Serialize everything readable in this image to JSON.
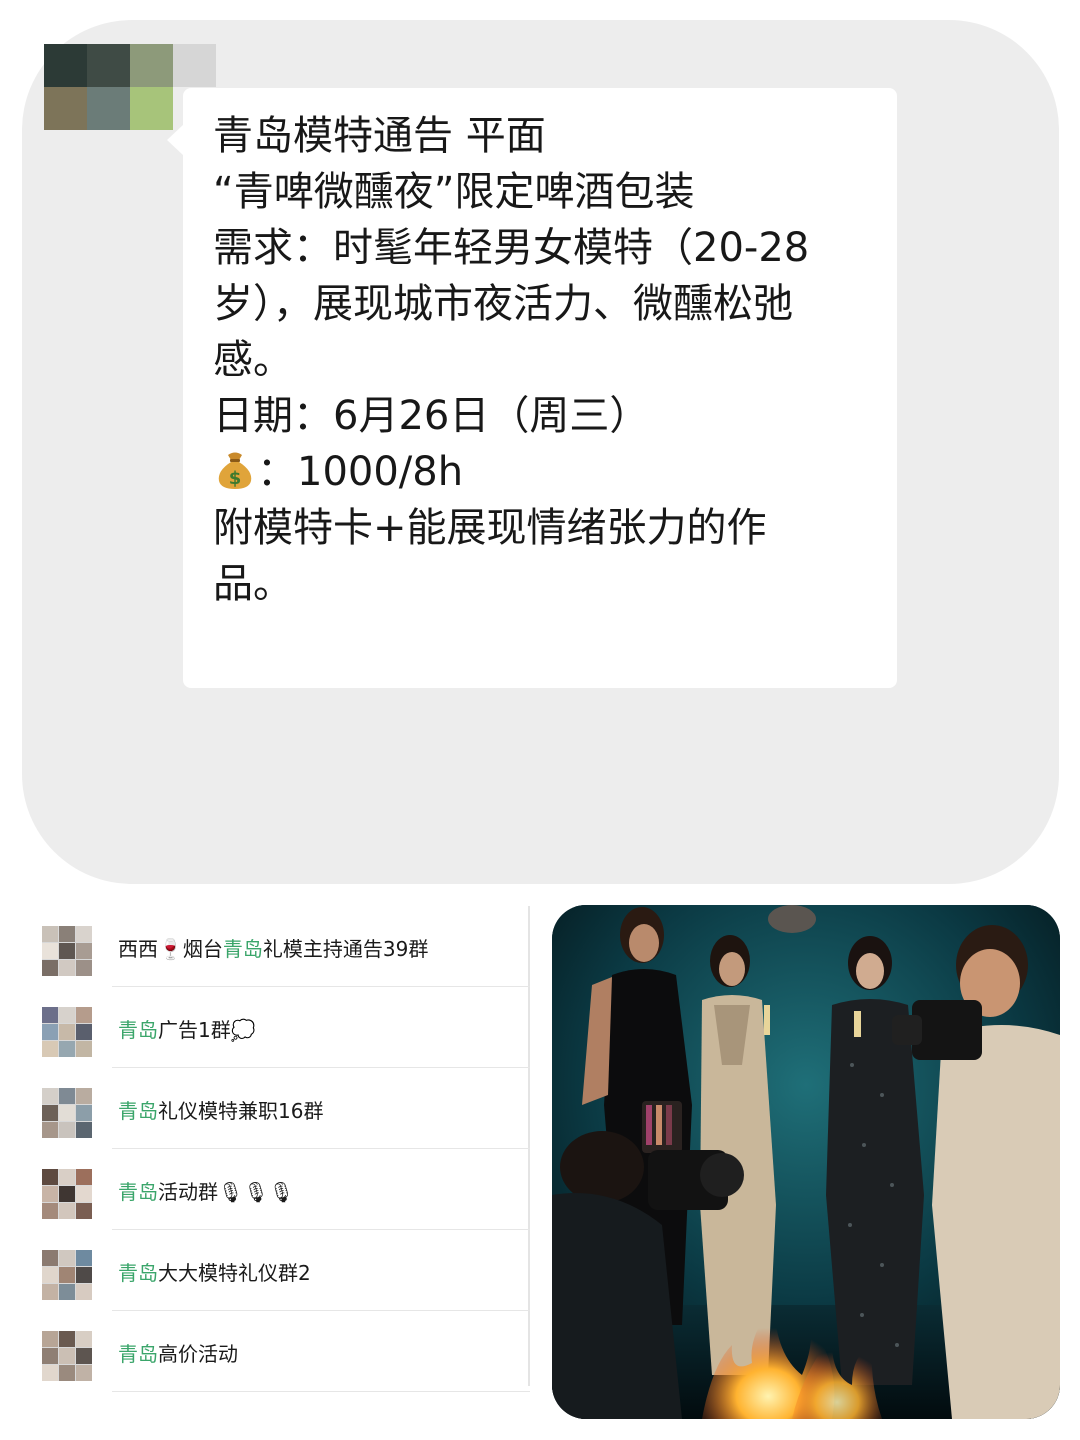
{
  "message": {
    "lines": [
      "青岛模特通告 平面",
      "“青啤微醺夜”限定啤酒包装",
      "需求：时髦年轻男女模特（20-28",
      "岁），展现城市夜活力、微醺松弛",
      "感。",
      "日期：6月26日（周三）",
      "：1000/8h",
      "附模特卡+能展现情绪张力的作",
      "品。"
    ],
    "pay_icon": "money-bag-icon"
  },
  "groups": [
    {
      "prefix": "西西🍷烟台",
      "highlight": "青岛",
      "suffix": "礼模主持通告39群"
    },
    {
      "prefix": "",
      "highlight": "青岛",
      "suffix": "广告1群💭"
    },
    {
      "prefix": "",
      "highlight": "青岛",
      "suffix": "礼仪模特兼职16群"
    },
    {
      "prefix": "",
      "highlight": "青岛",
      "suffix": "活动群🎙🎙🎙"
    },
    {
      "prefix": "",
      "highlight": "青岛",
      "suffix": "大大模特礼仪群2"
    },
    {
      "prefix": "",
      "highlight": "青岛",
      "suffix": "高价活动"
    }
  ],
  "colors": {
    "panel": "#ededed",
    "bubble": "#ffffff",
    "highlight": "#3aa56a",
    "photo_bg": "#06212a"
  }
}
